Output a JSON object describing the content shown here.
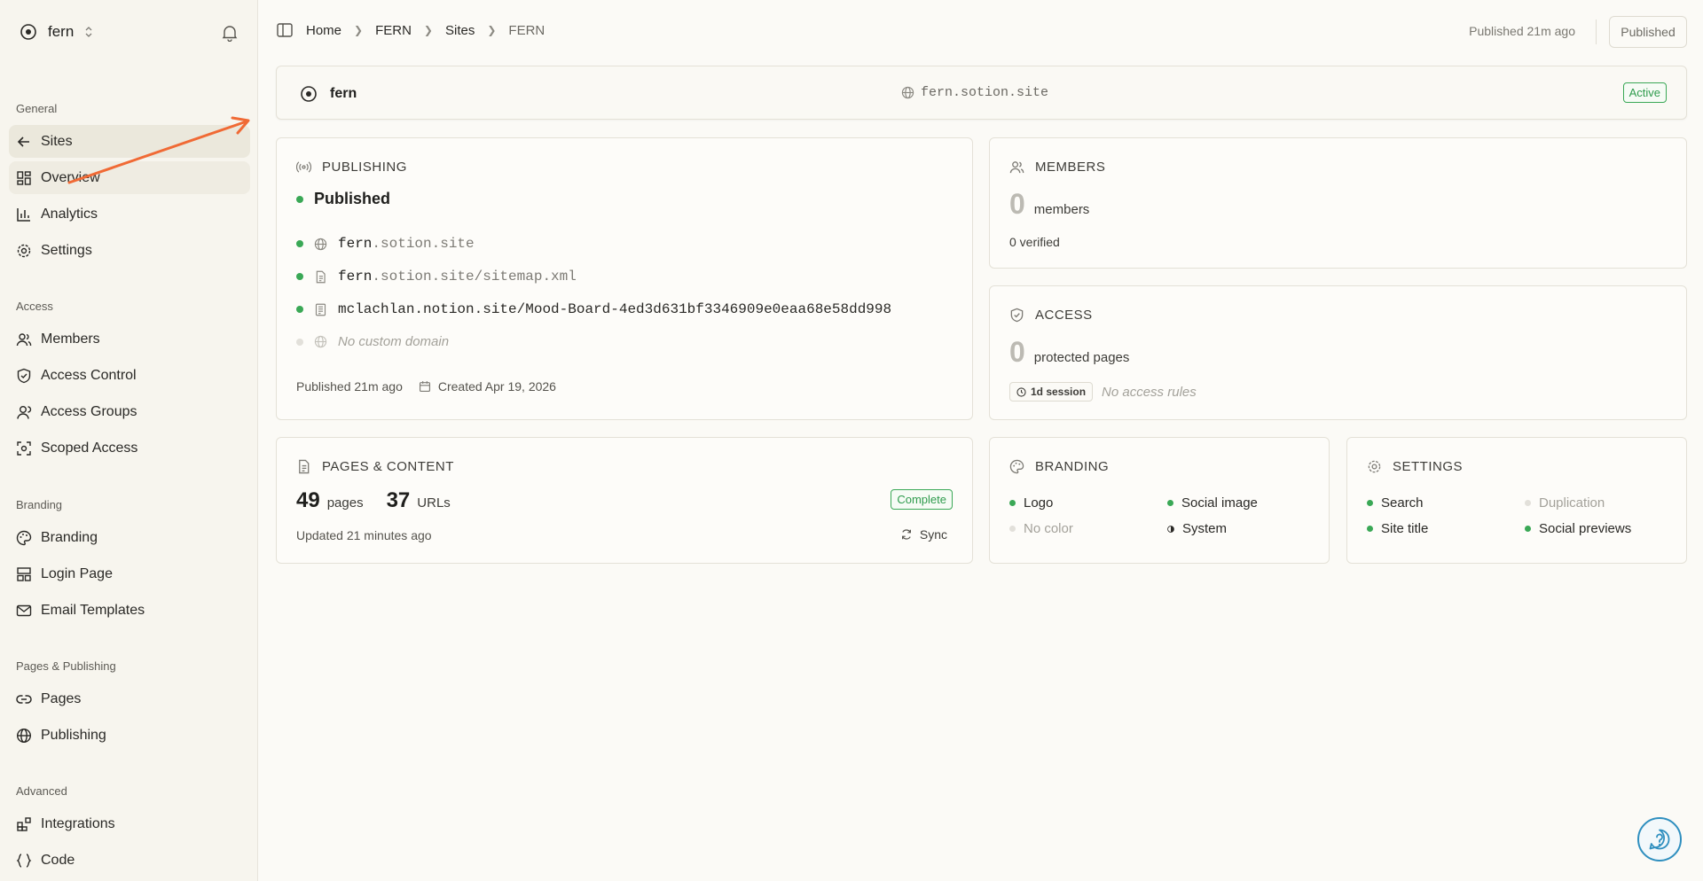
{
  "workspace": {
    "name": "fern"
  },
  "sidebar": {
    "sections": [
      {
        "label": "General",
        "items": [
          {
            "label": "Sites",
            "icon": "arrow-left-icon"
          },
          {
            "label": "Overview",
            "icon": "grid-icon"
          },
          {
            "label": "Analytics",
            "icon": "bar-chart-icon"
          },
          {
            "label": "Settings",
            "icon": "gear-icon"
          }
        ]
      },
      {
        "label": "Access",
        "items": [
          {
            "label": "Members",
            "icon": "users-icon"
          },
          {
            "label": "Access Control",
            "icon": "shield-icon"
          },
          {
            "label": "Access Groups",
            "icon": "user-group-icon"
          },
          {
            "label": "Scoped Access",
            "icon": "scope-icon"
          }
        ]
      },
      {
        "label": "Branding",
        "items": [
          {
            "label": "Branding",
            "icon": "palette-icon"
          },
          {
            "label": "Login Page",
            "icon": "layout-icon"
          },
          {
            "label": "Email Templates",
            "icon": "mail-icon"
          }
        ]
      },
      {
        "label": "Pages & Publishing",
        "items": [
          {
            "label": "Pages",
            "icon": "link-icon"
          },
          {
            "label": "Publishing",
            "icon": "globe-icon"
          }
        ]
      },
      {
        "label": "Advanced",
        "items": [
          {
            "label": "Integrations",
            "icon": "blocks-icon"
          },
          {
            "label": "Code",
            "icon": "braces-icon"
          }
        ]
      }
    ]
  },
  "breadcrumb": [
    "Home",
    "FERN",
    "Sites",
    "FERN"
  ],
  "topbar": {
    "published_ago": "Published 21m ago",
    "published_button": "Published"
  },
  "site": {
    "name": "fern",
    "domain": "fern.sotion.site",
    "status": "Active"
  },
  "publishing": {
    "title": "PUBLISHING",
    "status": "Published",
    "urls": [
      {
        "host": "fern",
        "rest": ".sotion.site"
      },
      {
        "host": "fern",
        "rest": ".sotion.site/sitemap.xml"
      },
      {
        "host": "mclachlan.notion.site/Mood-Board-4ed3d631bf3346909e0eaa68e58dd998",
        "rest": ""
      }
    ],
    "no_custom_domain": "No custom domain",
    "published_ago": "Published 21m ago",
    "created": "Created Apr 19, 2026"
  },
  "members": {
    "title": "MEMBERS",
    "count": "0",
    "count_label": "members",
    "verified": "0 verified"
  },
  "access": {
    "title": "ACCESS",
    "count": "0",
    "count_label": "protected pages",
    "session": "1d session",
    "rules": "No access rules"
  },
  "pages": {
    "title": "PAGES & CONTENT",
    "pages_count": "49",
    "pages_label": "pages",
    "urls_count": "37",
    "urls_label": "URLs",
    "status": "Complete",
    "updated": "Updated 21 minutes ago",
    "sync": "Sync"
  },
  "branding": {
    "title": "BRANDING",
    "items": [
      "Logo",
      "Social image",
      "No color",
      "System"
    ]
  },
  "settings": {
    "title": "SETTINGS",
    "items": [
      "Search",
      "Duplication",
      "Site title",
      "Social previews"
    ]
  },
  "colors": {
    "accent_green": "#3aa856",
    "arrow": "#f06a35"
  }
}
